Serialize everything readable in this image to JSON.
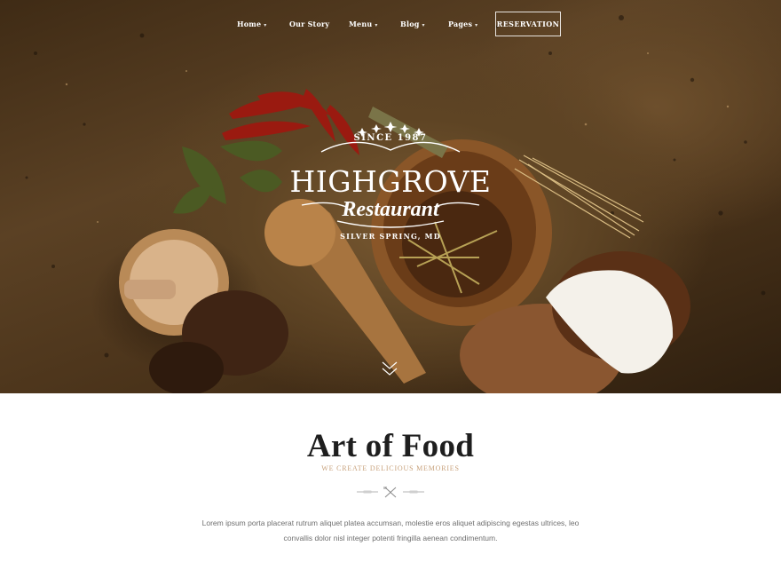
{
  "nav": {
    "items": [
      {
        "label": "Home",
        "dropdown": true
      },
      {
        "label": "Our Story",
        "dropdown": false
      },
      {
        "label": "Menu",
        "dropdown": true
      },
      {
        "label": "Blog",
        "dropdown": true
      },
      {
        "label": "Pages",
        "dropdown": true
      }
    ],
    "cta_label": "RESERVATION",
    "caret_glyph": "▾"
  },
  "hero": {
    "logo": {
      "since": "SINCE 1987",
      "name": "HIGHGROVE",
      "script": "Restaurant",
      "city": "SILVER SPRING, MD"
    },
    "scroll_icon": "chevron-double-down-icon"
  },
  "section": {
    "title": "Art of Food",
    "subtitle": "WE CREATE DELICIOUS MEMORIES",
    "divider_icon": "fork-knife-icon",
    "body": "Lorem ipsum porta placerat rutrum aliquet platea accumsan, molestie eros aliquet adipiscing egestas ultrices, leo convallis dolor nisl integer potenti fringilla aenean condimentum."
  },
  "colors": {
    "accent": "#c8a27c",
    "title": "#1e1e1e",
    "text": "#6f6f6f",
    "hero_bg": "#5b4124"
  }
}
